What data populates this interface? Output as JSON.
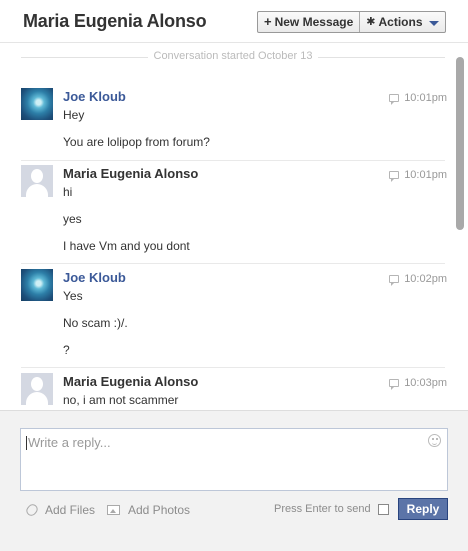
{
  "header": {
    "title": "Maria Eugenia Alonso",
    "new_message_label": "New Message",
    "actions_label": "Actions"
  },
  "thread": {
    "started_label": "Conversation started October 13",
    "messages": [
      {
        "author": "Joe Kloub",
        "time": "10:01pm",
        "avatar": "photo-avatar",
        "lines": [
          "Hey",
          "You are lolipop from forum?"
        ]
      },
      {
        "author": "Maria Eugenia Alonso",
        "time": "10:01pm",
        "avatar": "default-avatar",
        "lines": [
          "hi",
          "yes",
          "I have Vm and you dont"
        ]
      },
      {
        "author": "Joe Kloub",
        "time": "10:02pm",
        "avatar": "photo-avatar",
        "lines": [
          "Yes",
          "No scam :)/.",
          "?"
        ]
      },
      {
        "author": "Maria Eugenia Alonso",
        "time": "10:03pm",
        "avatar": "default-avatar",
        "lines": [
          "no, i am not scammer"
        ]
      }
    ]
  },
  "composer": {
    "placeholder": "Write a reply...",
    "add_files_label": "Add Files",
    "add_photos_label": "Add Photos",
    "press_enter_label": "Press Enter to send",
    "press_enter_checked": false,
    "reply_label": "Reply"
  },
  "colors": {
    "link_blue": "#3b5998",
    "reply_button": "#5b74a8",
    "composer_bg": "#f2f2f2"
  }
}
